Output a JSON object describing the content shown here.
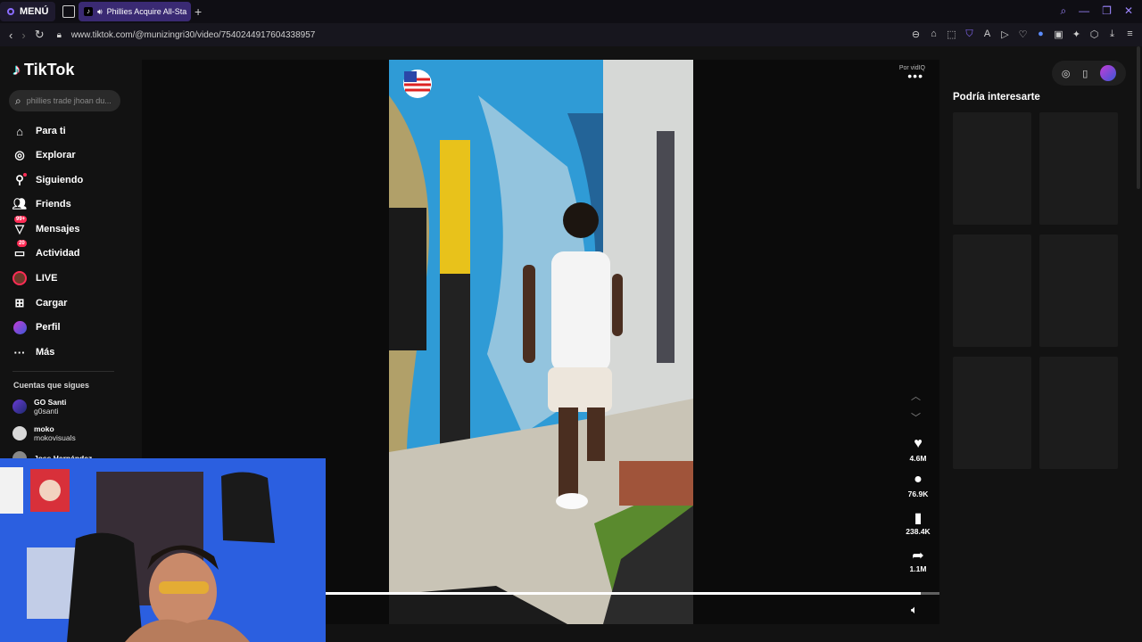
{
  "browser": {
    "menu_label": "MENÚ",
    "tab_title": "Phillies Acquire All-Sta",
    "url": "www.tiktok.com/@munizingri30/video/7540244917604338957"
  },
  "tiktok": {
    "logo_text": "TikTok",
    "search_placeholder": "phillies trade jhoan du...",
    "nav": [
      {
        "label": "Para ti",
        "icon": "home-icon"
      },
      {
        "label": "Explorar",
        "icon": "compass-icon"
      },
      {
        "label": "Siguiendo",
        "icon": "following-icon"
      },
      {
        "label": "Friends",
        "icon": "friends-icon"
      },
      {
        "label": "Mensajes",
        "icon": "messages-icon",
        "badge": "99+"
      },
      {
        "label": "Actividad",
        "icon": "activity-icon",
        "badge": "20"
      },
      {
        "label": "LIVE",
        "icon": "live-icon"
      },
      {
        "label": "Cargar",
        "icon": "upload-icon"
      },
      {
        "label": "Perfil",
        "icon": "profile-avatar"
      },
      {
        "label": "Más",
        "icon": "more-icon"
      }
    ],
    "following_title": "Cuentas que sigues",
    "accounts": [
      {
        "name": "GO Santi",
        "handle": "g0santi"
      },
      {
        "name": "moko",
        "handle": "mokovisuals"
      },
      {
        "name": "Joss Hernández",
        "handle": ""
      }
    ],
    "video": {
      "vidiq_label": "Por vidIQ",
      "likes": "4.6M",
      "comments": "76.9K",
      "saves": "238.4K",
      "shares": "1.1M",
      "progress": 0.97
    },
    "recommendations_title": "Podría interesarte"
  },
  "colors": {
    "accent_purple": "#3a2a73",
    "brand_red": "#fe2c55",
    "brand_cyan": "#25f4ee"
  }
}
